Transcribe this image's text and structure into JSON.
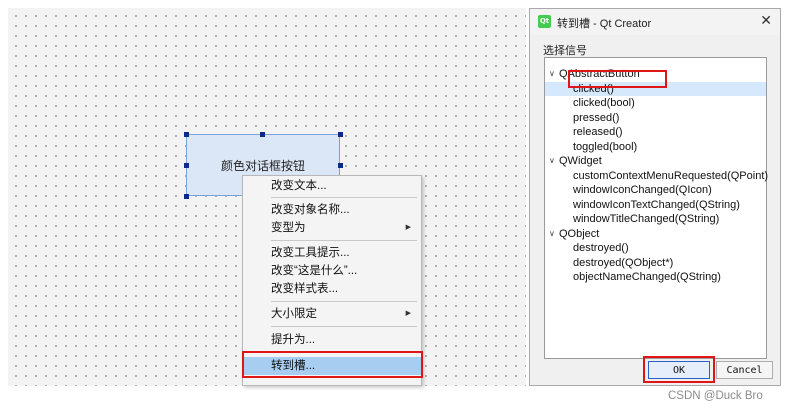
{
  "canvas": {
    "button_text": "颜色对话框按钮"
  },
  "context_menu": {
    "items": [
      {
        "label": "改变文本..."
      },
      {
        "label": "改变对象名称..."
      },
      {
        "label": "变型为",
        "submenu": true
      },
      {
        "label": "改变工具提示..."
      },
      {
        "label": "改变“这是什么”..."
      },
      {
        "label": "改变样式表..."
      },
      {
        "label": "大小限定",
        "submenu": true
      },
      {
        "label": "提升为..."
      },
      {
        "label": "转到槽...",
        "highlighted": true
      }
    ]
  },
  "dialog": {
    "title": "转到槽 - Qt Creator",
    "logo_text": "Qt",
    "group_label": "选择信号",
    "classes": [
      {
        "name": "QAbstractButton",
        "signals": [
          "clicked()",
          "clicked(bool)",
          "pressed()",
          "released()",
          "toggled(bool)"
        ]
      },
      {
        "name": "QWidget",
        "signals": [
          "customContextMenuRequested(QPoint)",
          "windowIconChanged(QIcon)",
          "windowIconTextChanged(QString)",
          "windowTitleChanged(QString)"
        ]
      },
      {
        "name": "QObject",
        "signals": [
          "destroyed()",
          "destroyed(QObject*)",
          "objectNameChanged(QString)"
        ]
      }
    ],
    "selected_signal": "clicked()",
    "ok_label": "OK",
    "cancel_label": "Cancel"
  },
  "watermark": "CSDN @Duck Bro",
  "colors": {
    "highlight_box": "#e01616",
    "menu_active": "#a7cdf0",
    "tree_selected": "#d6e8fb",
    "qt_green": "#41cd52"
  }
}
